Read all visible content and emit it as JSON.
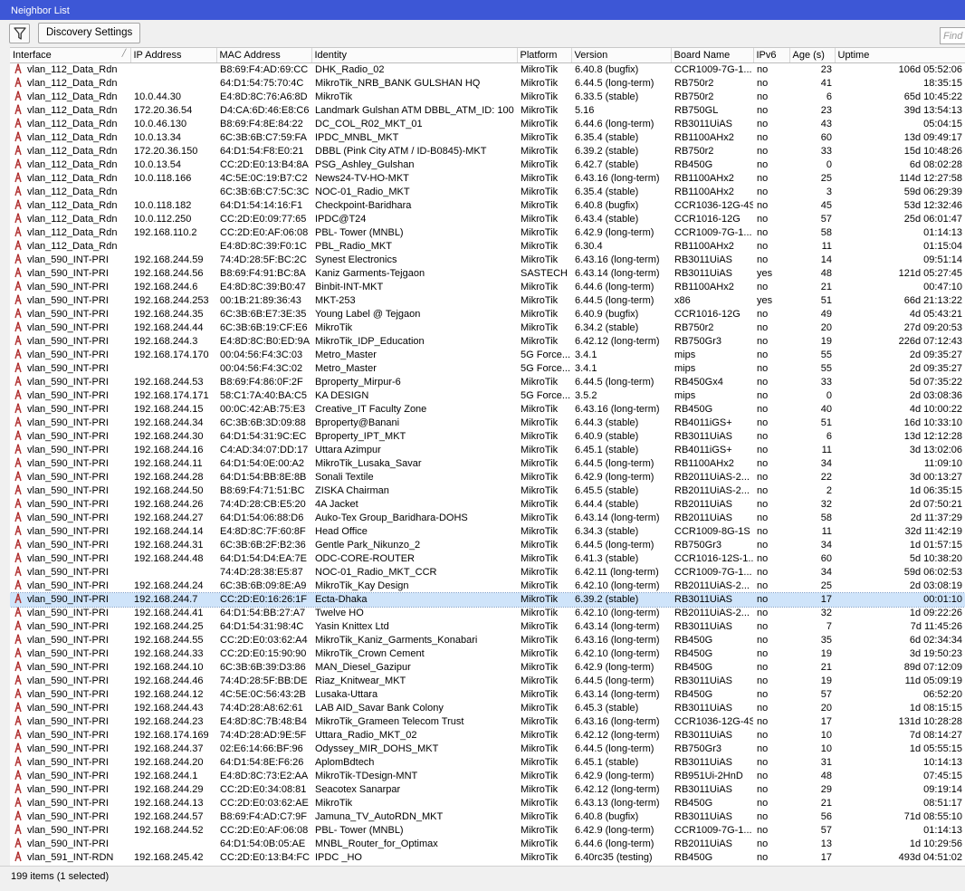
{
  "window": {
    "title": "Neighbor List"
  },
  "toolbar": {
    "filter_icon": "filter-icon",
    "discovery_label": "Discovery Settings",
    "find_placeholder": "Find"
  },
  "columns": [
    "Interface",
    "IP Address",
    "MAC Address",
    "Identity",
    "Platform",
    "Version",
    "Board Name",
    "IPv6",
    "Age (s)",
    "Uptime"
  ],
  "sorted_column": "Interface",
  "colors": {
    "title_bg": "#3d57d6",
    "selected_row": "#cfe4fa",
    "icon": "#b03030"
  },
  "rows": [
    [
      "vlan_112_Data_Rdn",
      "",
      "B8:69:F4:AD:69:CC",
      "DHK_Radio_02",
      "MikroTik",
      "6.40.8 (bugfix)",
      "CCR1009-7G-1...",
      "no",
      "23",
      "106d 05:52:06"
    ],
    [
      "vlan_112_Data_Rdn",
      "",
      "64:D1:54:75:70:4C",
      "MikroTik_NRB_BANK GULSHAN HQ",
      "MikroTik",
      "6.44.5 (long-term)",
      "RB750r2",
      "no",
      "41",
      "18:35:15"
    ],
    [
      "vlan_112_Data_Rdn",
      "10.0.44.30",
      "E4:8D:8C:76:A6:8D",
      "MikroTik",
      "MikroTik",
      "6.33.5 (stable)",
      "RB750r2",
      "no",
      "6",
      "65d 10:45:22"
    ],
    [
      "vlan_112_Data_Rdn",
      "172.20.36.54",
      "D4:CA:6D:46:E8:C6",
      "Landmark Gulshan ATM DBBL_ATM_ID: 100",
      "MikroTik",
      "5.16",
      "RB750GL",
      "no",
      "23",
      "39d 13:54:13"
    ],
    [
      "vlan_112_Data_Rdn",
      "10.0.46.130",
      "B8:69:F4:8E:84:22",
      "DC_COL_R02_MKT_01",
      "MikroTik",
      "6.44.6 (long-term)",
      "RB3011UiAS",
      "no",
      "43",
      "05:04:15"
    ],
    [
      "vlan_112_Data_Rdn",
      "10.0.13.34",
      "6C:3B:6B:C7:59:FA",
      "IPDC_MNBL_MKT",
      "MikroTik",
      "6.35.4 (stable)",
      "RB1100AHx2",
      "no",
      "60",
      "13d 09:49:17"
    ],
    [
      "vlan_112_Data_Rdn",
      "172.20.36.150",
      "64:D1:54:F8:E0:21",
      "DBBL (Pink City ATM / ID-B0845)-MKT",
      "MikroTik",
      "6.39.2 (stable)",
      "RB750r2",
      "no",
      "33",
      "15d 10:48:26"
    ],
    [
      "vlan_112_Data_Rdn",
      "10.0.13.54",
      "CC:2D:E0:13:B4:8A",
      "PSG_Ashley_Gulshan",
      "MikroTik",
      "6.42.7 (stable)",
      "RB450G",
      "no",
      "0",
      "6d 08:02:28"
    ],
    [
      "vlan_112_Data_Rdn",
      "10.0.118.166",
      "4C:5E:0C:19:B7:C2",
      "News24-TV-HO-MKT",
      "MikroTik",
      "6.43.16 (long-term)",
      "RB1100AHx2",
      "no",
      "25",
      "114d 12:27:58"
    ],
    [
      "vlan_112_Data_Rdn",
      "",
      "6C:3B:6B:C7:5C:3C",
      "NOC-01_Radio_MKT",
      "MikroTik",
      "6.35.4 (stable)",
      "RB1100AHx2",
      "no",
      "3",
      "59d 06:29:39"
    ],
    [
      "vlan_112_Data_Rdn",
      "10.0.118.182",
      "64:D1:54:14:16:F1",
      "Checkpoint-Baridhara",
      "MikroTik",
      "6.40.8 (bugfix)",
      "CCR1036-12G-4S",
      "no",
      "45",
      "53d 12:32:46"
    ],
    [
      "vlan_112_Data_Rdn",
      "10.0.112.250",
      "CC:2D:E0:09:77:65",
      "IPDC@T24",
      "MikroTik",
      "6.43.4 (stable)",
      "CCR1016-12G",
      "no",
      "57",
      "25d 06:01:47"
    ],
    [
      "vlan_112_Data_Rdn",
      "192.168.110.2",
      "CC:2D:E0:AF:06:08",
      "PBL- Tower (MNBL)",
      "MikroTik",
      "6.42.9 (long-term)",
      "CCR1009-7G-1...",
      "no",
      "58",
      "01:14:13"
    ],
    [
      "vlan_112_Data_Rdn",
      "",
      "E4:8D:8C:39:F0:1C",
      "PBL_Radio_MKT",
      "MikroTik",
      "6.30.4",
      "RB1100AHx2",
      "no",
      "11",
      "01:15:04"
    ],
    [
      "vlan_590_INT-PRI",
      "192.168.244.59",
      "74:4D:28:5F:BC:2C",
      "Synest Electronics",
      "MikroTik",
      "6.43.16 (long-term)",
      "RB3011UiAS",
      "no",
      "14",
      "09:51:14"
    ],
    [
      "vlan_590_INT-PRI",
      "192.168.244.56",
      "B8:69:F4:91:BC:8A",
      "Kaniz Garments-Tejgaon",
      "SASTECH",
      "6.43.14 (long-term)",
      "RB3011UiAS",
      "yes",
      "48",
      "121d 05:27:45"
    ],
    [
      "vlan_590_INT-PRI",
      "192.168.244.6",
      "E4:8D:8C:39:B0:47",
      "Binbit-INT-MKT",
      "MikroTik",
      "6.44.6 (long-term)",
      "RB1100AHx2",
      "no",
      "21",
      "00:47:10"
    ],
    [
      "vlan_590_INT-PRI",
      "192.168.244.253",
      "00:1B:21:89:36:43",
      "MKT-253",
      "MikroTik",
      "6.44.5 (long-term)",
      "x86",
      "yes",
      "51",
      "66d 21:13:22"
    ],
    [
      "vlan_590_INT-PRI",
      "192.168.244.35",
      "6C:3B:6B:E7:3E:35",
      "Young Label @ Tejgaon",
      "MikroTik",
      "6.40.9 (bugfix)",
      "CCR1016-12G",
      "no",
      "49",
      "4d 05:43:21"
    ],
    [
      "vlan_590_INT-PRI",
      "192.168.244.44",
      "6C:3B:6B:19:CF:E6",
      "MikroTik",
      "MikroTik",
      "6.34.2 (stable)",
      "RB750r2",
      "no",
      "20",
      "27d 09:20:53"
    ],
    [
      "vlan_590_INT-PRI",
      "192.168.244.3",
      "E4:8D:8C:B0:ED:9A",
      "MikroTik_IDP_Education",
      "MikroTik",
      "6.42.12 (long-term)",
      "RB750Gr3",
      "no",
      "19",
      "226d 07:12:43"
    ],
    [
      "vlan_590_INT-PRI",
      "192.168.174.170",
      "00:04:56:F4:3C:03",
      "Metro_Master",
      "5G Force...",
      "3.4.1",
      "mips",
      "no",
      "55",
      "2d 09:35:27"
    ],
    [
      "vlan_590_INT-PRI",
      "",
      "00:04:56:F4:3C:02",
      "Metro_Master",
      "5G Force...",
      "3.4.1",
      "mips",
      "no",
      "55",
      "2d 09:35:27"
    ],
    [
      "vlan_590_INT-PRI",
      "192.168.244.53",
      "B8:69:F4:86:0F:2F",
      "Bproperty_Mirpur-6",
      "MikroTik",
      "6.44.5 (long-term)",
      "RB450Gx4",
      "no",
      "33",
      "5d 07:35:22"
    ],
    [
      "vlan_590_INT-PRI",
      "192.168.174.171",
      "58:C1:7A:40:BA:C5",
      "KA DESIGN",
      "5G Force...",
      "3.5.2",
      "mips",
      "no",
      "0",
      "2d 03:08:36"
    ],
    [
      "vlan_590_INT-PRI",
      "192.168.244.15",
      "00:0C:42:AB:75:E3",
      "Creative_IT Faculty Zone",
      "MikroTik",
      "6.43.16 (long-term)",
      "RB450G",
      "no",
      "40",
      "4d 10:00:22"
    ],
    [
      "vlan_590_INT-PRI",
      "192.168.244.34",
      "6C:3B:6B:3D:09:88",
      "Bproperty@Banani",
      "MikroTik",
      "6.44.3 (stable)",
      "RB4011iGS+",
      "no",
      "51",
      "16d 10:33:10"
    ],
    [
      "vlan_590_INT-PRI",
      "192.168.244.30",
      "64:D1:54:31:9C:EC",
      "Bproperty_IPT_MKT",
      "MikroTik",
      "6.40.9 (stable)",
      "RB3011UiAS",
      "no",
      "6",
      "13d 12:12:28"
    ],
    [
      "vlan_590_INT-PRI",
      "192.168.244.16",
      "C4:AD:34:07:DD:17",
      "Uttara Azimpur",
      "MikroTik",
      "6.45.1 (stable)",
      "RB4011iGS+",
      "no",
      "11",
      "3d 13:02:06"
    ],
    [
      "vlan_590_INT-PRI",
      "192.168.244.11",
      "64:D1:54:0E:00:A2",
      "MikroTik_Lusaka_Savar",
      "MikroTik",
      "6.44.5 (long-term)",
      "RB1100AHx2",
      "no",
      "34",
      "11:09:10"
    ],
    [
      "vlan_590_INT-PRI",
      "192.168.244.28",
      "64:D1:54:BB:8E:8B",
      "Sonali Textile",
      "MikroTik",
      "6.42.9 (long-term)",
      "RB2011UiAS-2...",
      "no",
      "22",
      "3d 00:13:27"
    ],
    [
      "vlan_590_INT-PRI",
      "192.168.244.50",
      "B8:69:F4:71:51:BC",
      "ZISKA Chairman",
      "MikroTik",
      "6.45.5 (stable)",
      "RB2011UiAS-2...",
      "no",
      "2",
      "1d 06:35:15"
    ],
    [
      "vlan_590_INT-PRI",
      "192.168.244.26",
      "74:4D:28:CB:E5:20",
      "4A Jacket",
      "MikroTik",
      "6.44.4 (stable)",
      "RB2011UiAS",
      "no",
      "32",
      "2d 07:50:21"
    ],
    [
      "vlan_590_INT-PRI",
      "192.168.244.27",
      "64:D1:54:06:88:D6",
      "Auko-Tex Group_Baridhara-DOHS",
      "MikroTik",
      "6.43.14 (long-term)",
      "RB2011UiAS",
      "no",
      "58",
      "2d 11:37:29"
    ],
    [
      "vlan_590_INT-PRI",
      "192.168.244.14",
      "E4:8D:8C:7F:60:8F",
      "Head Office",
      "MikroTik",
      "6.34.3 (stable)",
      "CCR1009-8G-1S",
      "no",
      "11",
      "32d 11:42:19"
    ],
    [
      "vlan_590_INT-PRI",
      "192.168.244.31",
      "6C:3B:6B:2F:B2:36",
      "Gentle Park_Nikunzo_2",
      "MikroTik",
      "6.44.5 (long-term)",
      "RB750Gr3",
      "no",
      "34",
      "1d 01:57:15"
    ],
    [
      "vlan_590_INT-PRI",
      "192.168.244.48",
      "64:D1:54:D4:EA:7E",
      "ODC-CORE-ROUTER",
      "MikroTik",
      "6.41.3 (stable)",
      "CCR1016-12S-1...",
      "no",
      "60",
      "5d 10:38:20"
    ],
    [
      "vlan_590_INT-PRI",
      "",
      "74:4D:28:38:E5:87",
      "NOC-01_Radio_MKT_CCR",
      "MikroTik",
      "6.42.11 (long-term)",
      "CCR1009-7G-1...",
      "no",
      "34",
      "59d 06:02:53"
    ],
    [
      "vlan_590_INT-PRI",
      "192.168.244.24",
      "6C:3B:6B:09:8E:A9",
      "MikroTik_Kay Design",
      "MikroTik",
      "6.42.10 (long-term)",
      "RB2011UiAS-2...",
      "no",
      "25",
      "2d 03:08:19"
    ],
    [
      "vlan_590_INT-PRI",
      "192.168.244.7",
      "CC:2D:E0:16:26:1F",
      "Ecta-Dhaka",
      "MikroTik",
      "6.39.2 (stable)",
      "RB3011UiAS",
      "no",
      "17",
      "00:01:10"
    ],
    [
      "vlan_590_INT-PRI",
      "192.168.244.41",
      "64:D1:54:BB:27:A7",
      "Twelve HO",
      "MikroTik",
      "6.42.10 (long-term)",
      "RB2011UiAS-2...",
      "no",
      "32",
      "1d 09:22:26"
    ],
    [
      "vlan_590_INT-PRI",
      "192.168.244.25",
      "64:D1:54:31:98:4C",
      "Yasin Knittex Ltd",
      "MikroTik",
      "6.43.14 (long-term)",
      "RB3011UiAS",
      "no",
      "7",
      "7d 11:45:26"
    ],
    [
      "vlan_590_INT-PRI",
      "192.168.244.55",
      "CC:2D:E0:03:62:A4",
      "MikroTik_Kaniz_Garments_Konabari",
      "MikroTik",
      "6.43.16 (long-term)",
      "RB450G",
      "no",
      "35",
      "6d 02:34:34"
    ],
    [
      "vlan_590_INT-PRI",
      "192.168.244.33",
      "CC:2D:E0:15:90:90",
      "MikroTik_Crown Cement",
      "MikroTik",
      "6.42.10 (long-term)",
      "RB450G",
      "no",
      "19",
      "3d 19:50:23"
    ],
    [
      "vlan_590_INT-PRI",
      "192.168.244.10",
      "6C:3B:6B:39:D3:86",
      "MAN_Diesel_Gazipur",
      "MikroTik",
      "6.42.9 (long-term)",
      "RB450G",
      "no",
      "21",
      "89d 07:12:09"
    ],
    [
      "vlan_590_INT-PRI",
      "192.168.244.46",
      "74:4D:28:5F:BB:DE",
      "Riaz_Knitwear_MKT",
      "MikroTik",
      "6.44.5 (long-term)",
      "RB3011UiAS",
      "no",
      "19",
      "11d 05:09:19"
    ],
    [
      "vlan_590_INT-PRI",
      "192.168.244.12",
      "4C:5E:0C:56:43:2B",
      "Lusaka-Uttara",
      "MikroTik",
      "6.43.14 (long-term)",
      "RB450G",
      "no",
      "57",
      "06:52:20"
    ],
    [
      "vlan_590_INT-PRI",
      "192.168.244.43",
      "74:4D:28:A8:62:61",
      "LAB AID_Savar Bank Colony",
      "MikroTik",
      "6.45.3 (stable)",
      "RB3011UiAS",
      "no",
      "20",
      "1d 08:15:15"
    ],
    [
      "vlan_590_INT-PRI",
      "192.168.244.23",
      "E4:8D:8C:7B:48:B4",
      "MikroTik_Grameen Telecom Trust",
      "MikroTik",
      "6.43.16 (long-term)",
      "CCR1036-12G-4S",
      "no",
      "17",
      "131d 10:28:28"
    ],
    [
      "vlan_590_INT-PRI",
      "192.168.174.169",
      "74:4D:28:AD:9E:5F",
      "Uttara_Radio_MKT_02",
      "MikroTik",
      "6.42.12 (long-term)",
      "RB3011UiAS",
      "no",
      "10",
      "7d 08:14:27"
    ],
    [
      "vlan_590_INT-PRI",
      "192.168.244.37",
      "02:E6:14:66:BF:96",
      "Odyssey_MIR_DOHS_MKT",
      "MikroTik",
      "6.44.5 (long-term)",
      "RB750Gr3",
      "no",
      "10",
      "1d 05:55:15"
    ],
    [
      "vlan_590_INT-PRI",
      "192.168.244.20",
      "64:D1:54:8E:F6:26",
      "AplomBdtech",
      "MikroTik",
      "6.45.1 (stable)",
      "RB3011UiAS",
      "no",
      "31",
      "10:14:13"
    ],
    [
      "vlan_590_INT-PRI",
      "192.168.244.1",
      "E4:8D:8C:73:E2:AA",
      "MikroTik-TDesign-MNT",
      "MikroTik",
      "6.42.9 (long-term)",
      "RB951Ui-2HnD",
      "no",
      "48",
      "07:45:15"
    ],
    [
      "vlan_590_INT-PRI",
      "192.168.244.29",
      "CC:2D:E0:34:08:81",
      "Seacotex Sanarpar",
      "MikroTik",
      "6.42.12 (long-term)",
      "RB3011UiAS",
      "no",
      "29",
      "09:19:14"
    ],
    [
      "vlan_590_INT-PRI",
      "192.168.244.13",
      "CC:2D:E0:03:62:AE",
      "MikroTik",
      "MikroTik",
      "6.43.13 (long-term)",
      "RB450G",
      "no",
      "21",
      "08:51:17"
    ],
    [
      "vlan_590_INT-PRI",
      "192.168.244.57",
      "B8:69:F4:AD:C7:9F",
      "Jamuna_TV_AutoRDN_MKT",
      "MikroTik",
      "6.40.8 (bugfix)",
      "RB3011UiAS",
      "no",
      "56",
      "71d 08:55:10"
    ],
    [
      "vlan_590_INT-PRI",
      "192.168.244.52",
      "CC:2D:E0:AF:06:08",
      "PBL- Tower (MNBL)",
      "MikroTik",
      "6.42.9 (long-term)",
      "CCR1009-7G-1...",
      "no",
      "57",
      "01:14:13"
    ],
    [
      "vlan_590_INT-PRI",
      "",
      "64:D1:54:0B:05:AE",
      "MNBL_Router_for_Optimax",
      "MikroTik",
      "6.44.6 (long-term)",
      "RB2011UiAS",
      "no",
      "13",
      "1d 10:29:56"
    ],
    [
      "vlan_591_INT-RDN",
      "192.168.245.42",
      "CC:2D:E0:13:B4:FC",
      "IPDC _HO",
      "MikroTik",
      "6.40rc35 (testing)",
      "RB450G",
      "no",
      "17",
      "493d 04:51:02"
    ]
  ],
  "selected_row": 39,
  "status": {
    "text": "199 items (1 selected)"
  }
}
